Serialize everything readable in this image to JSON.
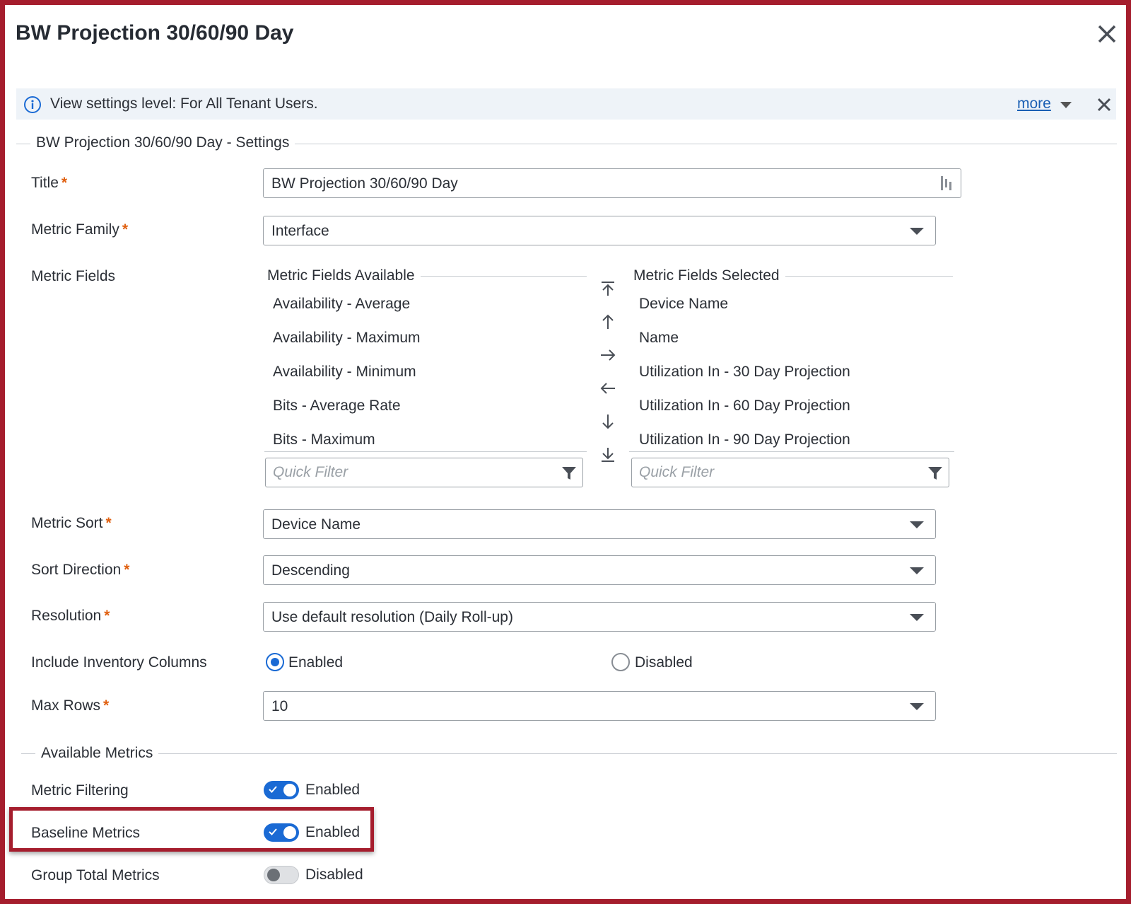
{
  "dialog": {
    "title": "BW Projection 30/60/90 Day"
  },
  "banner": {
    "text": "View settings level: For All Tenant Users.",
    "more_label": "more"
  },
  "settings_section": {
    "legend": "BW Projection 30/60/90 Day - Settings",
    "title": {
      "label": "Title",
      "value": "BW Projection 30/60/90 Day"
    },
    "metric_family": {
      "label": "Metric Family",
      "value": "Interface"
    },
    "metric_fields": {
      "label": "Metric Fields",
      "available_header": "Metric Fields Available",
      "selected_header": "Metric Fields Selected",
      "available": [
        "Availability - Average",
        "Availability - Maximum",
        "Availability - Minimum",
        "Bits - Average Rate",
        "Bits - Maximum"
      ],
      "selected": [
        "Device Name",
        "Name",
        "Utilization In - 30 Day Projection",
        "Utilization In - 60 Day Projection",
        "Utilization In - 90 Day Projection"
      ],
      "filter_placeholder": "Quick Filter"
    },
    "metric_sort": {
      "label": "Metric Sort",
      "value": "Device Name"
    },
    "sort_direction": {
      "label": "Sort Direction",
      "value": "Descending"
    },
    "resolution": {
      "label": "Resolution",
      "value": "Use default resolution (Daily Roll-up)"
    },
    "inventory_columns": {
      "label": "Include Inventory Columns",
      "option_enabled": "Enabled",
      "option_disabled": "Disabled",
      "selected": "Enabled"
    },
    "max_rows": {
      "label": "Max Rows",
      "value": "10"
    }
  },
  "available_metrics": {
    "legend": "Available Metrics",
    "metric_filtering": {
      "label": "Metric Filtering",
      "state": "Enabled"
    },
    "baseline_metrics": {
      "label": "Baseline Metrics",
      "state": "Enabled"
    },
    "group_total_metrics": {
      "label": "Group Total Metrics",
      "state": "Disabled"
    }
  },
  "required_marker": "*",
  "colors": {
    "accent": "#1a6ad4",
    "required": "#e06010",
    "highlight": "#a51d2d",
    "link": "#1a5fb4"
  }
}
